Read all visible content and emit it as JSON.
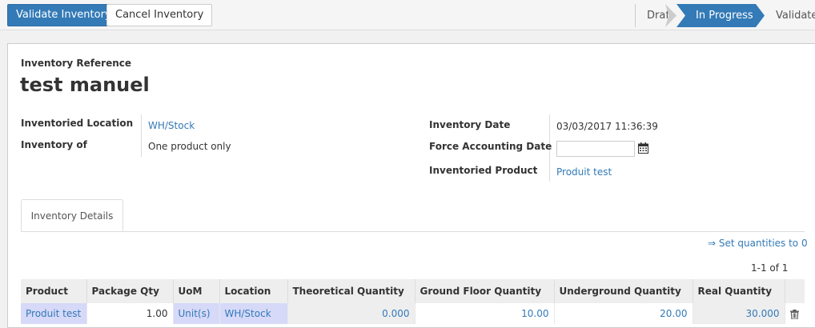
{
  "actions": {
    "validate_label": "Validate Inventory",
    "cancel_label": "Cancel Inventory"
  },
  "stages": {
    "draft": "Draft",
    "in_progress": "In Progress",
    "validated": "Validated",
    "active": "In Progress"
  },
  "form": {
    "reference_label": "Inventory Reference",
    "reference_value": "test manuel",
    "location_label": "Inventoried Location",
    "location_value": "WH/Stock",
    "inventory_of_label": "Inventory of",
    "inventory_of_value": "One product only",
    "date_label": "Inventory Date",
    "date_value": "03/03/2017 11:36:39",
    "force_date_label": "Force Accounting Date",
    "force_date_value": "",
    "product_label": "Inventoried Product",
    "product_value": "Produit test"
  },
  "tabs": [
    {
      "label": "Inventory Details"
    }
  ],
  "details": {
    "set_quantities_label": "⇒ Set quantities to 0",
    "pager": "1-1 of 1",
    "columns": [
      "Product",
      "Package Qty",
      "UoM",
      "Location",
      "Theoretical Quantity",
      "Ground Floor Quantity",
      "Underground Quantity",
      "Real Quantity"
    ],
    "rows": [
      {
        "product": "Produit test",
        "package_qty": "1.00",
        "uom": "Unit(s)",
        "location": "WH/Stock",
        "theoretical_qty": "0.000",
        "ground_floor_qty": "10.00",
        "underground_qty": "20.00",
        "real_qty": "30.000"
      }
    ]
  },
  "icons": {
    "calendar": "calendar-icon",
    "delete": "trash-icon"
  },
  "colors": {
    "primary": "#337ab7",
    "readonly_cell": "#d6d9f8",
    "link": "#337ab7"
  }
}
